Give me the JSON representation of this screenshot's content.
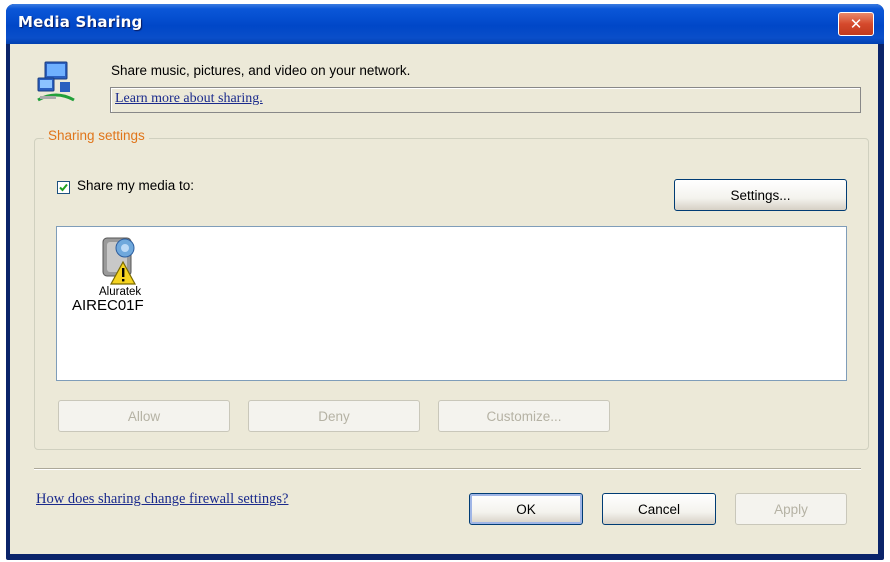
{
  "window": {
    "title": "Media Sharing",
    "close_glyph": "✕"
  },
  "header": {
    "text": "Share music, pictures, and video on your network.",
    "link": "Learn more about sharing.",
    "icon": "media-sharing-network-icon"
  },
  "sharing": {
    "group_label": "Sharing settings",
    "share_checkbox": {
      "label": "Share my media to:",
      "checked": true
    },
    "settings_button": "Settings...",
    "devices": [
      {
        "brand": "Aluratek",
        "name": "AIREC01F",
        "icon": "media-device-warning-icon"
      }
    ],
    "allow_button": "Allow",
    "deny_button": "Deny",
    "customize_button": "Customize..."
  },
  "footer": {
    "firewall_link": "How does sharing change firewall settings?",
    "ok_button": "OK",
    "cancel_button": "Cancel",
    "apply_button": "Apply"
  },
  "colors": {
    "titlebar": "#0047c8",
    "group_label": "#e0751a",
    "link": "#1a2a8c",
    "client_bg": "#ece9d8"
  }
}
